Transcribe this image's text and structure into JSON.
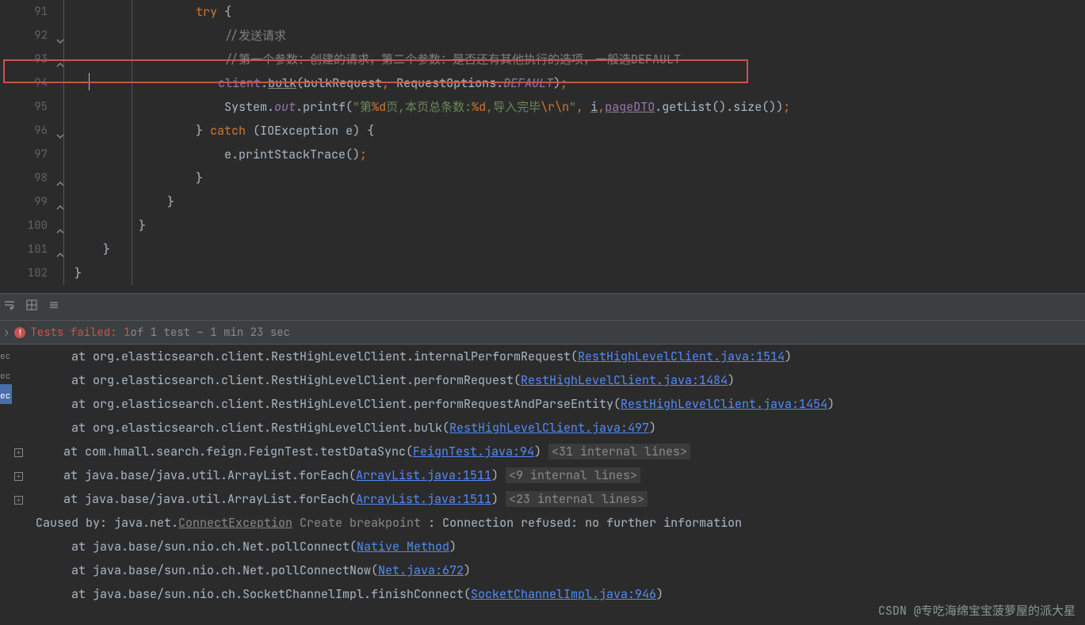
{
  "editor": {
    "lines": [
      {
        "num": "91",
        "fold": "none"
      },
      {
        "num": "92",
        "fold": "down"
      },
      {
        "num": "93",
        "fold": "up"
      },
      {
        "num": "94",
        "fold": "none"
      },
      {
        "num": "95",
        "fold": "none"
      },
      {
        "num": "96",
        "fold": "down"
      },
      {
        "num": "97",
        "fold": "none"
      },
      {
        "num": "98",
        "fold": "up"
      },
      {
        "num": "99",
        "fold": "up"
      },
      {
        "num": "100",
        "fold": "up"
      },
      {
        "num": "101",
        "fold": "up"
      },
      {
        "num": "102",
        "fold": "none"
      }
    ],
    "tokens": {
      "try": "try",
      "ob": " {",
      "c1": "//发送请求",
      "c2": "//第一个参数：创建的请求，第二个参数：是否还有其他执行的选项，一般选DEFAULT",
      "client": "client",
      "dot": ".",
      "bulk": "bulk",
      "lp": "(",
      "bulkReq": "bulkRequest",
      "comma": ",",
      "sp": " ",
      "reqOpt": "RequestOptions",
      "default": "DEFAULT",
      "rp": ")",
      "semi": ";",
      "system": "System",
      "out": "out",
      "printf": "printf",
      "s1": "\"第",
      "s2": "%d",
      "s3": "页,本页总条数:",
      "s4": "%d",
      "s5": ",导入完毕",
      "esc1": "\\r",
      "esc2": "\\n",
      "s6": "\"",
      "i": "i",
      "pageDTO": "pageDTO",
      "getList": ".getList().size())",
      "cb": "}",
      "catch": "catch",
      "ioe": " (IOException e) {",
      "eprint": "e.printStackTrace()"
    }
  },
  "status": {
    "label": "Tests failed:",
    "count": "1",
    "rest": " of 1 test – 1 min 23 sec"
  },
  "leftStrip": [
    "ec",
    "ec",
    "ec"
  ],
  "trace": [
    {
      "pre": "        at org.elasticsearch.client.RestHighLevelClient.internalPerformRequest(",
      "link": "RestHighLevelClient.java:1514",
      "post": ")"
    },
    {
      "pre": "        at org.elasticsearch.client.RestHighLevelClient.performRequest(",
      "link": "RestHighLevelClient.java:1484",
      "post": ")"
    },
    {
      "pre": "        at org.elasticsearch.client.RestHighLevelClient.performRequestAndParseEntity(",
      "link": "RestHighLevelClient.java:1454",
      "post": ")"
    },
    {
      "pre": "        at org.elasticsearch.client.RestHighLevelClient.bulk(",
      "link": "RestHighLevelClient.java:497",
      "post": ")"
    },
    {
      "expand": true,
      "pre": "     at com.hmall.search.feign.FeignTest.testDataSync(",
      "link": "FeignTest.java:94",
      "post": ") ",
      "internal": "<31 internal lines>"
    },
    {
      "expand": true,
      "pre": "     at java.base/java.util.ArrayList.forEach(",
      "link": "ArrayList.java:1511",
      "post": ") ",
      "internal": "<9 internal lines>"
    },
    {
      "expand": true,
      "pre": "     at java.base/java.util.ArrayList.forEach(",
      "link": "ArrayList.java:1511",
      "post": ") ",
      "internal": "<23 internal lines>"
    },
    {
      "caused": true,
      "pre": "   Caused by: java.net.",
      "cls": "ConnectException",
      "hint": "Create breakpoint",
      "msg": " : Connection refused: no further information"
    },
    {
      "pre": "        at java.base/sun.nio.ch.Net.pollConnect(",
      "link": "Native Method",
      "post": ")"
    },
    {
      "pre": "        at java.base/sun.nio.ch.Net.pollConnectNow(",
      "link": "Net.java:672",
      "post": ")"
    },
    {
      "pre": "        at java.base/sun.nio.ch.SocketChannelImpl.finishConnect(",
      "link": "SocketChannelImpl.java:946",
      "post": ")"
    }
  ],
  "watermark": "CSDN @专吃海绵宝宝菠萝屋的派大星"
}
